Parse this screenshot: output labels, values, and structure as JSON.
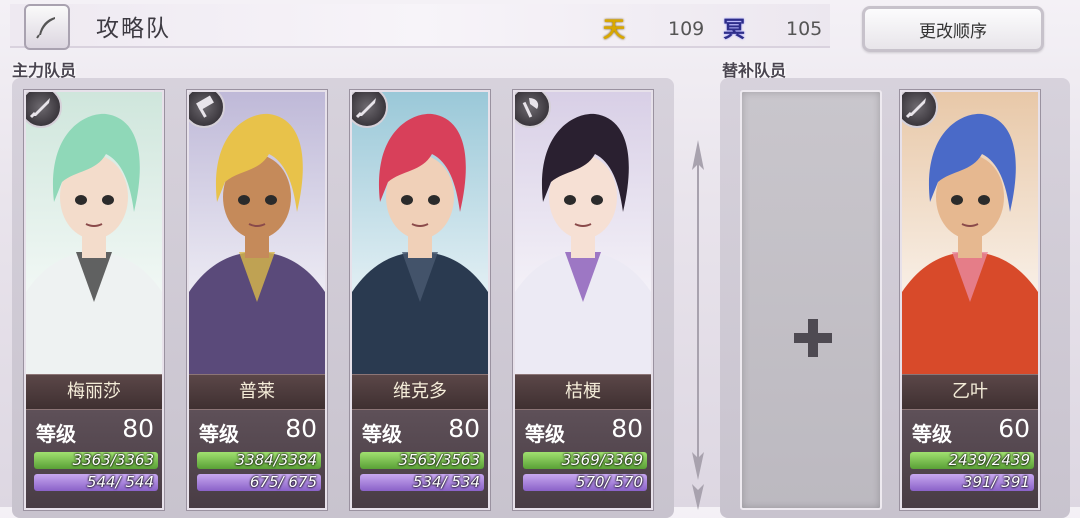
{
  "header": {
    "title": "攻略队",
    "stat1": {
      "icon": "天",
      "value": "109",
      "color": "#d9a800"
    },
    "stat2": {
      "icon": "冥",
      "value": "105",
      "color": "#3a3a8a"
    },
    "reorder_label": "更改顺序"
  },
  "sections": {
    "main_label": "主力队员",
    "sub_label": "替补队员"
  },
  "level_label": "等级",
  "main_members": [
    {
      "name": "梅丽莎",
      "level": "80",
      "hp": "3363/3363",
      "mp": "544/ 544",
      "hp_fill": 1.0,
      "mp_fill": 1.0,
      "weapon": "sword-icon",
      "palette": {
        "hair": "#8fd8b8",
        "skin": "#f3dccb",
        "cloth": "#eef2f2",
        "accent": "#3c3c3c",
        "bg": "#cfe6dc"
      }
    },
    {
      "name": "普莱",
      "level": "80",
      "hp": "3384/3384",
      "mp": "675/ 675",
      "hp_fill": 1.0,
      "mp_fill": 1.0,
      "weapon": "hammer-icon",
      "palette": {
        "hair": "#e8c24a",
        "skin": "#c58a5a",
        "cloth": "#5a4a7a",
        "accent": "#d8b84a",
        "bg": "#bfb9d8"
      }
    },
    {
      "name": "维克多",
      "level": "80",
      "hp": "3563/3563",
      "mp": "534/ 534",
      "hp_fill": 1.0,
      "mp_fill": 1.0,
      "weapon": "sword-icon",
      "palette": {
        "hair": "#d8405a",
        "skin": "#f0d0b8",
        "cloth": "#2a3a50",
        "accent": "#4a5a70",
        "bg": "#9ac8d8"
      }
    },
    {
      "name": "桔梗",
      "level": "80",
      "hp": "3369/3369",
      "mp": "570/ 570",
      "hp_fill": 1.0,
      "mp_fill": 1.0,
      "weapon": "axe-icon",
      "palette": {
        "hair": "#2a2030",
        "skin": "#f6e0d4",
        "cloth": "#eceaf4",
        "accent": "#8a5ab8",
        "bg": "#d8cfe6"
      }
    }
  ],
  "sub_members": [
    {
      "name": "乙叶",
      "level": "60",
      "hp": "2439/2439",
      "mp": "391/ 391",
      "hp_fill": 1.0,
      "mp_fill": 1.0,
      "weapon": "sword-icon",
      "palette": {
        "hair": "#4a6ac8",
        "skin": "#e6b890",
        "cloth": "#d84a2a",
        "accent": "#e88aa0",
        "bg": "#e8c8a8"
      }
    }
  ]
}
